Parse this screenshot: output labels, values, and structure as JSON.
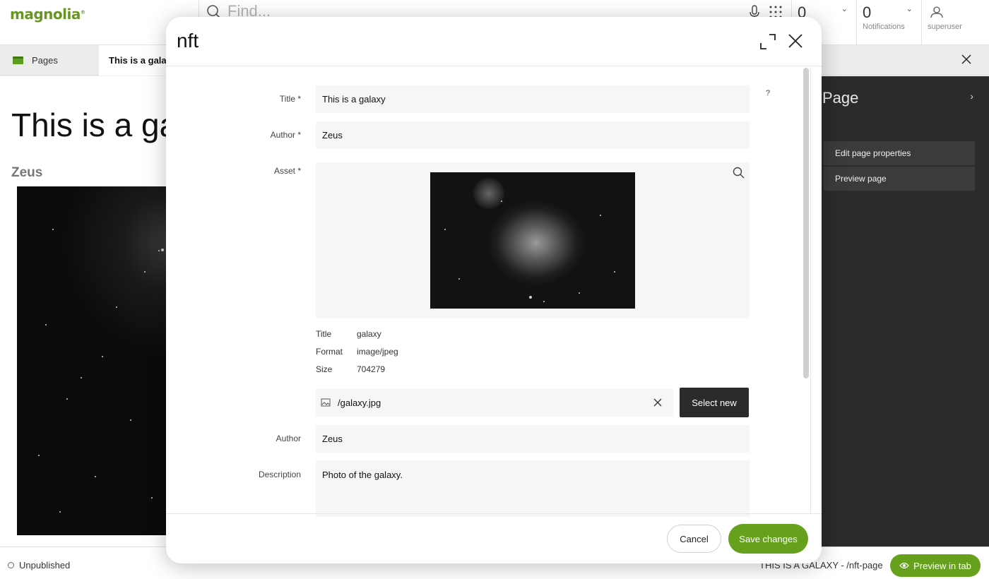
{
  "app": {
    "logo": "magnolia",
    "logo_mark": "®"
  },
  "topbar": {
    "search_placeholder": "Find...",
    "tasks_count": "0",
    "notifications_count": "0",
    "notifications_label": "Notifications",
    "user_label": "superuser"
  },
  "tabs": {
    "pages_label": "Pages",
    "active_label": "This is a galaxy"
  },
  "preview": {
    "title": "This is a galaxy",
    "author": "Zeus"
  },
  "right_panel": {
    "title": "Page",
    "actions": [
      "Edit page properties",
      "Preview page"
    ]
  },
  "statusbar": {
    "status": "Unpublished",
    "path": "THIS IS A GALAXY - /nft-page",
    "preview_tab_label": "Preview in tab"
  },
  "dialog": {
    "title": "nft",
    "help_mark": "?",
    "fields": {
      "title_label": "Title *",
      "title_value": "This is a galaxy",
      "author_label": "Author *",
      "author_value": "Zeus",
      "asset_label": "Asset *",
      "asset_author_label": "Author",
      "asset_author_value": "Zeus",
      "description_label": "Description",
      "description_value": "Photo of the galaxy."
    },
    "asset_meta": {
      "title_label": "Title",
      "title_value": "galaxy",
      "format_label": "Format",
      "format_value": "image/jpeg",
      "size_label": "Size",
      "size_value": "704279"
    },
    "asset_file": "/galaxy.jpg",
    "select_new_label": "Select new",
    "cancel_label": "Cancel",
    "save_label": "Save changes"
  },
  "colors": {
    "accent": "#66a11e",
    "dark_panel": "#2b2b2b"
  }
}
